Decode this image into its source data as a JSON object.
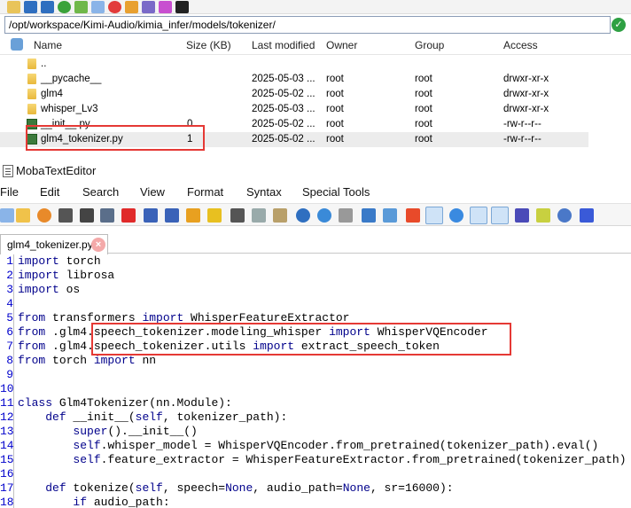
{
  "sftp": {
    "path": "/opt/workspace/Kimi-Audio/kimia_infer/models/tokenizer/",
    "columns": {
      "name": "Name",
      "size": "Size (KB)",
      "modified": "Last modified",
      "owner": "Owner",
      "group": "Group",
      "access": "Access"
    },
    "files": [
      {
        "name": "..",
        "size": "",
        "modified": "",
        "owner": "",
        "group": "",
        "access": "",
        "type": "folder"
      },
      {
        "name": "__pycache__",
        "size": "",
        "modified": "2025-05-03 ...",
        "owner": "root",
        "group": "root",
        "access": "drwxr-xr-x",
        "type": "folder"
      },
      {
        "name": "glm4",
        "size": "",
        "modified": "2025-05-02 ...",
        "owner": "root",
        "group": "root",
        "access": "drwxr-xr-x",
        "type": "folder"
      },
      {
        "name": "whisper_Lv3",
        "size": "",
        "modified": "2025-05-03 ...",
        "owner": "root",
        "group": "root",
        "access": "drwxr-xr-x",
        "type": "folder"
      },
      {
        "name": "__init__.py",
        "size": "0",
        "modified": "2025-05-02 ...",
        "owner": "root",
        "group": "root",
        "access": "-rw-r--r--",
        "type": "py"
      },
      {
        "name": "glm4_tokenizer.py",
        "size": "1",
        "modified": "2025-05-02 ...",
        "owner": "root",
        "group": "root",
        "access": "-rw-r--r--",
        "type": "py"
      }
    ]
  },
  "editor": {
    "title": "MobaTextEditor",
    "menu": [
      "File",
      "Edit",
      "Search",
      "View",
      "Format",
      "Syntax",
      "Special Tools"
    ],
    "tab_label": "glm4_tokenizer.py",
    "tab_close": "×"
  },
  "code_lines": [
    {
      "n": "1",
      "text": "import torch"
    },
    {
      "n": "2",
      "text": "import librosa"
    },
    {
      "n": "3",
      "text": "import os"
    },
    {
      "n": "4",
      "text": ""
    },
    {
      "n": "5",
      "text": "from transformers import WhisperFeatureExtractor"
    },
    {
      "n": "6",
      "text": "from .glm4.speech_tokenizer.modeling_whisper import WhisperVQEncoder"
    },
    {
      "n": "7",
      "text": "from .glm4.speech_tokenizer.utils import extract_speech_token"
    },
    {
      "n": "8",
      "text": "from torch import nn"
    },
    {
      "n": "9",
      "text": ""
    },
    {
      "n": "10",
      "text": ""
    },
    {
      "n": "11",
      "text": "class Glm4Tokenizer(nn.Module):"
    },
    {
      "n": "12",
      "text": "    def __init__(self, tokenizer_path):"
    },
    {
      "n": "13",
      "text": "        super().__init__()"
    },
    {
      "n": "14",
      "text": "        self.whisper_model = WhisperVQEncoder.from_pretrained(tokenizer_path).eval()"
    },
    {
      "n": "15",
      "text": "        self.feature_extractor = WhisperFeatureExtractor.from_pretrained(tokenizer_path)"
    },
    {
      "n": "16",
      "text": ""
    },
    {
      "n": "17",
      "text": "    def tokenize(self, speech=None, audio_path=None, sr=16000):"
    },
    {
      "n": "18",
      "text": "        if audio_path:"
    }
  ],
  "colors": {
    "keyword": "#00008b",
    "line_number": "#0000cc",
    "highlight_box": "#e53935",
    "ok": "#2ea043"
  }
}
